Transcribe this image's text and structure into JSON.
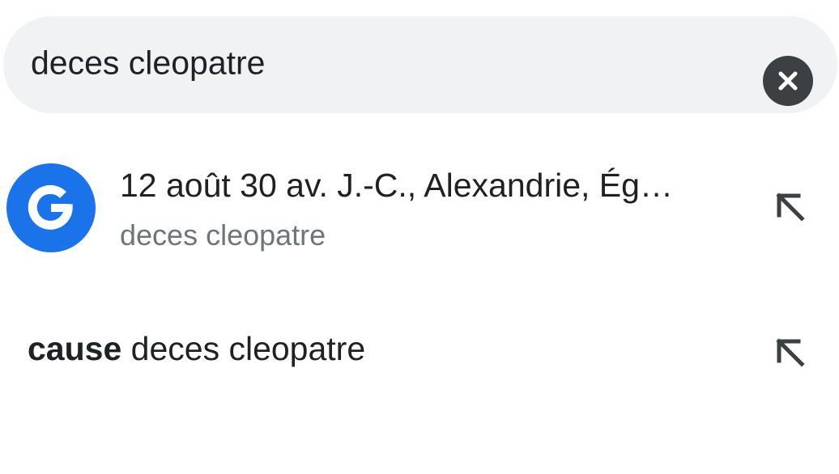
{
  "search": {
    "query": "deces cleopatre"
  },
  "suggestions": [
    {
      "title": "12 août 30 av. J.-C., Alexandrie, Ég…",
      "subtitle": "deces cleopatre",
      "icon": "google-g-icon"
    },
    {
      "bold": "cause",
      "rest": " deces cleopatre"
    }
  ],
  "colors": {
    "search_bg": "#f1f2f4",
    "google_blue": "#1a73e8",
    "clear_button": "#3c4043",
    "subtitle": "#70757a"
  }
}
